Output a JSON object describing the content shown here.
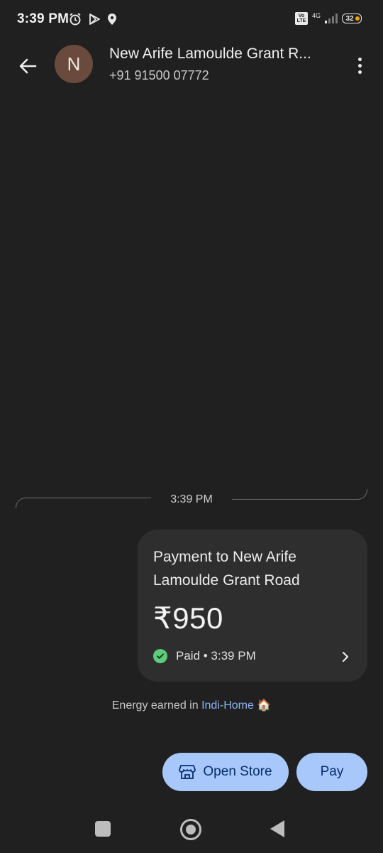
{
  "status_bar": {
    "time": "3:39 PM",
    "left_icons": [
      "alarm-icon",
      "play-store-icon",
      "location-icon"
    ],
    "volte": "Vo LTE",
    "network": "4G",
    "battery": "32",
    "battery_dot_color": "#f5a300"
  },
  "header": {
    "avatar_letter": "N",
    "avatar_color": "#6b4a3e",
    "contact_name": "New Arife Lamoulde Grant R...",
    "contact_phone": "+91 91500 07772"
  },
  "conversation": {
    "timestamp": "3:39 PM",
    "payment": {
      "title": "Payment to New Arife Lamoulde Grant Road",
      "amount": "₹950",
      "status": "Paid • 3:39 PM",
      "status_color": "#5ccb7a"
    },
    "energy": {
      "prefix": "Energy earned in ",
      "link": "Indi-Home",
      "emoji": "🏠"
    }
  },
  "actions": {
    "open_store": "Open Store",
    "pay": "Pay",
    "button_color": "#a8c7fa"
  }
}
